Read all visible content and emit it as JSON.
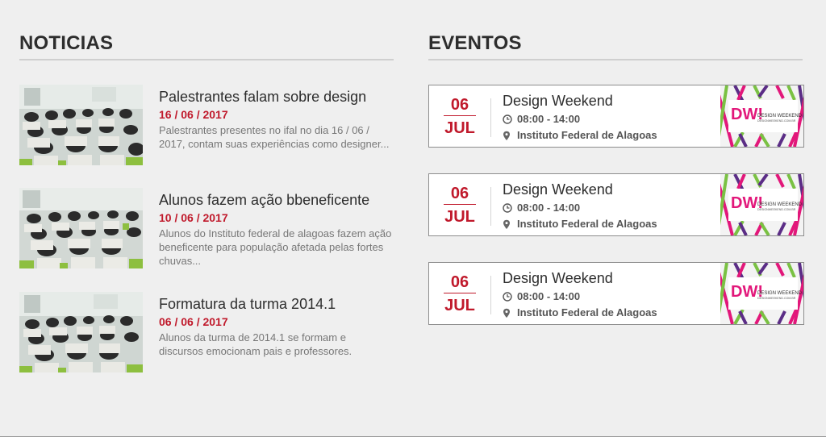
{
  "news": {
    "heading": "NOTICIAS",
    "items": [
      {
        "title": "Palestrantes falam sobre design",
        "date": "16 / 06 / 2017",
        "excerpt": "Palestrantes presentes no ifal no dia 16 / 06 / 2017, contam suas experiências como designer..."
      },
      {
        "title": "Alunos fazem ação bbeneficente",
        "date": "10 / 06 / 2017",
        "excerpt": "Alunos do Instituto federal de alagoas fazem ação beneficente para população afetada pelas fortes chuvas..."
      },
      {
        "title": "Formatura da turma 2014.1",
        "date": "06 / 06 / 2017",
        "excerpt": "Alunos da turma de 2014.1 se formam e discursos emocionam pais e professores."
      }
    ]
  },
  "events": {
    "heading": "EVENTOS",
    "items": [
      {
        "day": "06",
        "month": "JUL",
        "title": "Design Weekend",
        "time": "08:00 - 14:00",
        "place": "Instituto Federal de Alagoas",
        "logo_text": "DW!",
        "logo_caption": "DESIGN WEEKEND",
        "logo_url": "DESIGNWEEKEND.COM.BR"
      },
      {
        "day": "06",
        "month": "JUL",
        "title": "Design Weekend",
        "time": "08:00 - 14:00",
        "place": "Instituto Federal de Alagoas",
        "logo_text": "DW!",
        "logo_caption": "DESIGN WEEKEND",
        "logo_url": "DESIGNWEEKEND.COM.BR"
      },
      {
        "day": "06",
        "month": "JUL",
        "title": "Design Weekend",
        "time": "08:00 - 14:00",
        "place": "Instituto Federal de Alagoas",
        "logo_text": "DW!",
        "logo_caption": "DESIGN WEEKEND",
        "logo_url": "DESIGNWEEKEND.COM.BR"
      }
    ]
  },
  "icons": {
    "time": "clock-icon",
    "place": "map-pin-icon"
  },
  "colors": {
    "accent": "#c0192b",
    "background": "#efefef",
    "title": "#2d2d2d",
    "excerpt": "#777777"
  }
}
